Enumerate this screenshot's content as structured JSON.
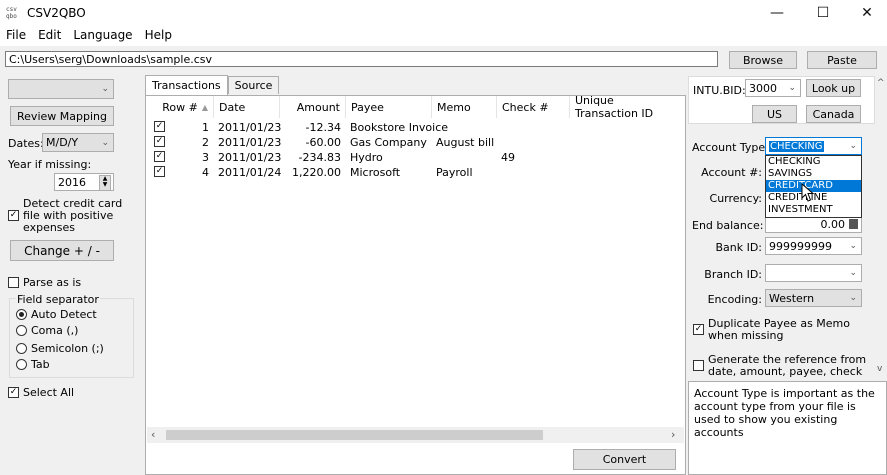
{
  "window": {
    "app_icon_top": "csv",
    "app_icon_bottom": "qbo",
    "title": "CSV2QBO",
    "minimize_glyph": "—",
    "maximize_glyph": "☐",
    "close_glyph": "✕"
  },
  "menu": [
    "File",
    "Edit",
    "Language",
    "Help"
  ],
  "path": {
    "value": "C:\\Users\\serg\\Downloads\\sample.csv",
    "browse_label": "Browse",
    "paste_label": "Paste"
  },
  "left": {
    "review_mapping_label": "Review Mapping",
    "dates_label": "Dates:",
    "dates_value": "M/D/Y",
    "year_label": "Year if missing:",
    "year_value": "2016",
    "detect_credit_label": "Detect credit card file with positive expenses",
    "change_label": "Change + / -",
    "parse_as_is_label": "Parse as is",
    "field_separator_label": "Field separator",
    "separators": [
      "Auto Detect",
      "Coma (,)",
      "Semicolon (;)",
      "Tab"
    ],
    "select_all_label": "Select All"
  },
  "tabs": [
    "Transactions",
    "Source"
  ],
  "table": {
    "columns": [
      "Row #",
      "Date",
      "Amount",
      "Payee",
      "Memo",
      "Check #",
      "Unique Transaction ID"
    ],
    "rows": [
      {
        "row": "1",
        "date": "2011/01/23",
        "amount": "-12.34",
        "payee": "Bookstore Invoice",
        "memo": "",
        "check": ""
      },
      {
        "row": "2",
        "date": "2011/01/23",
        "amount": "-60.00",
        "payee": "Gas Company",
        "memo": "August bill",
        "check": ""
      },
      {
        "row": "3",
        "date": "2011/01/23",
        "amount": "-234.83",
        "payee": "Hydro",
        "memo": "",
        "check": "49"
      },
      {
        "row": "4",
        "date": "2011/01/24",
        "amount": "1,220.00",
        "payee": "Microsoft",
        "memo": "Payroll",
        "check": ""
      }
    ],
    "convert_label": "Convert"
  },
  "right": {
    "intu_bid_label": "INTU.BID:",
    "intu_bid_value": "3000",
    "lookup_label": "Look up",
    "us_label": "US",
    "canada_label": "Canada",
    "account_type_label": "Account Type:",
    "account_type_value": "CHECKING",
    "account_type_options": [
      "CHECKING",
      "SAVINGS",
      "CREDITCARD",
      "CREDITLINE",
      "INVESTMENT"
    ],
    "account_num_label": "Account #:",
    "currency_label": "Currency:",
    "end_balance_label": "End balance:",
    "end_balance_value": "0.00",
    "bank_id_label": "Bank ID:",
    "bank_id_value": "999999999",
    "branch_id_label": "Branch ID:",
    "encoding_label": "Encoding:",
    "encoding_value": "Western",
    "duplicate_payee_label": "Duplicate Payee as Memo when missing",
    "generate_ref_label": "Generate the reference from date, amount, payee, check",
    "help_text": "Account Type is important as the account type from your file is used to show you existing accounts"
  }
}
